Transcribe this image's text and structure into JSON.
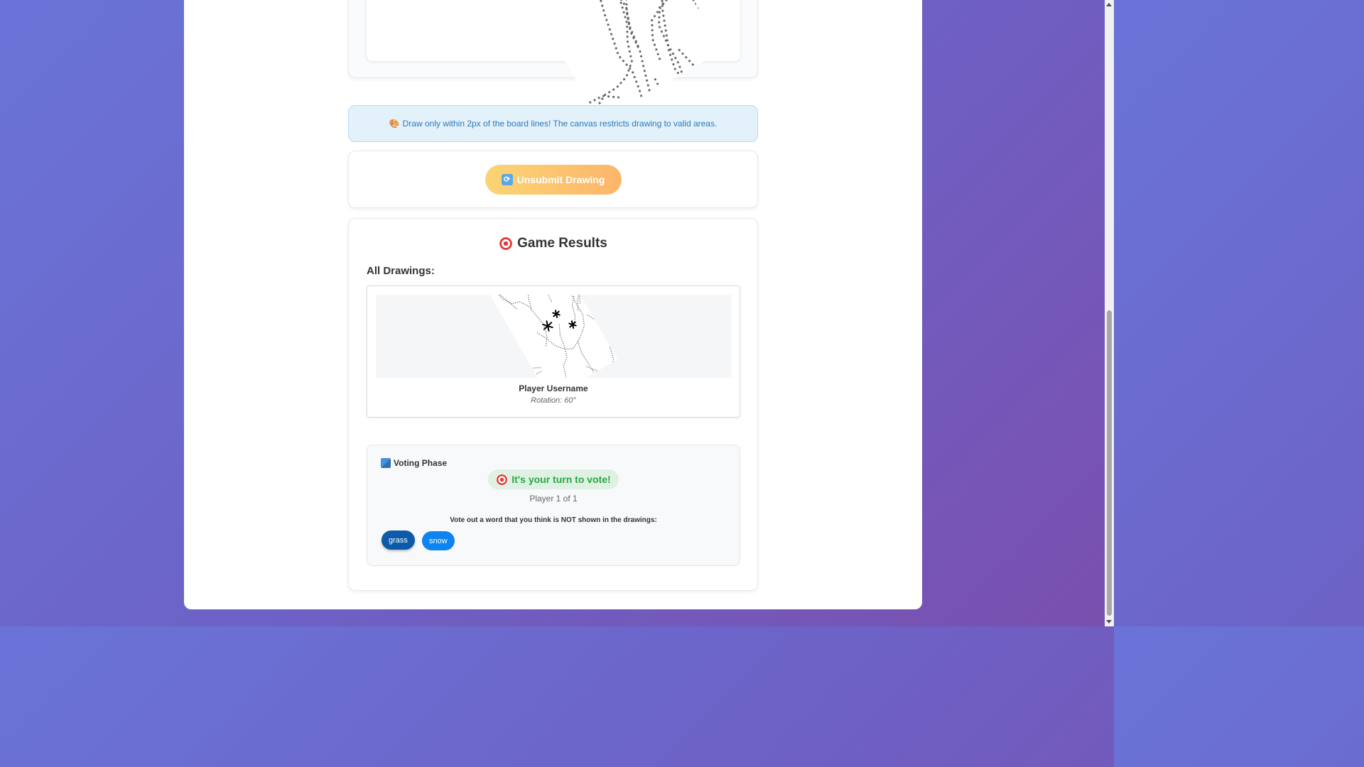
{
  "info": {
    "emoji": "🎨",
    "text": "Draw only within 2px of the board lines! The canvas restricts drawing to valid areas."
  },
  "actions": {
    "unsubmit_icon": "refresh-icon",
    "unsubmit_label": "Unsubmit Drawing"
  },
  "results": {
    "icon": "target-icon",
    "title": "Game Results",
    "all_drawings_label": "All Drawings:",
    "drawings": [
      {
        "player": "Player Username",
        "rotation": "Rotation: 60°"
      }
    ]
  },
  "voting": {
    "icon": "ballot-box-icon",
    "header": "Voting Phase",
    "turn_text": "It's your turn to vote!",
    "player_count": "Player 1 of 1",
    "instructions": "Vote out a word that you think is NOT shown in the drawings:",
    "words": [
      "grass",
      "snow"
    ],
    "selected_word": "grass"
  },
  "colors": {
    "accent_blue": "#0d84f0",
    "selected_blue": "#0c5aa9",
    "success_green": "#28a745",
    "unsubmit_gradient_start": "#fbd474",
    "unsubmit_gradient_end": "#fdb56a"
  }
}
